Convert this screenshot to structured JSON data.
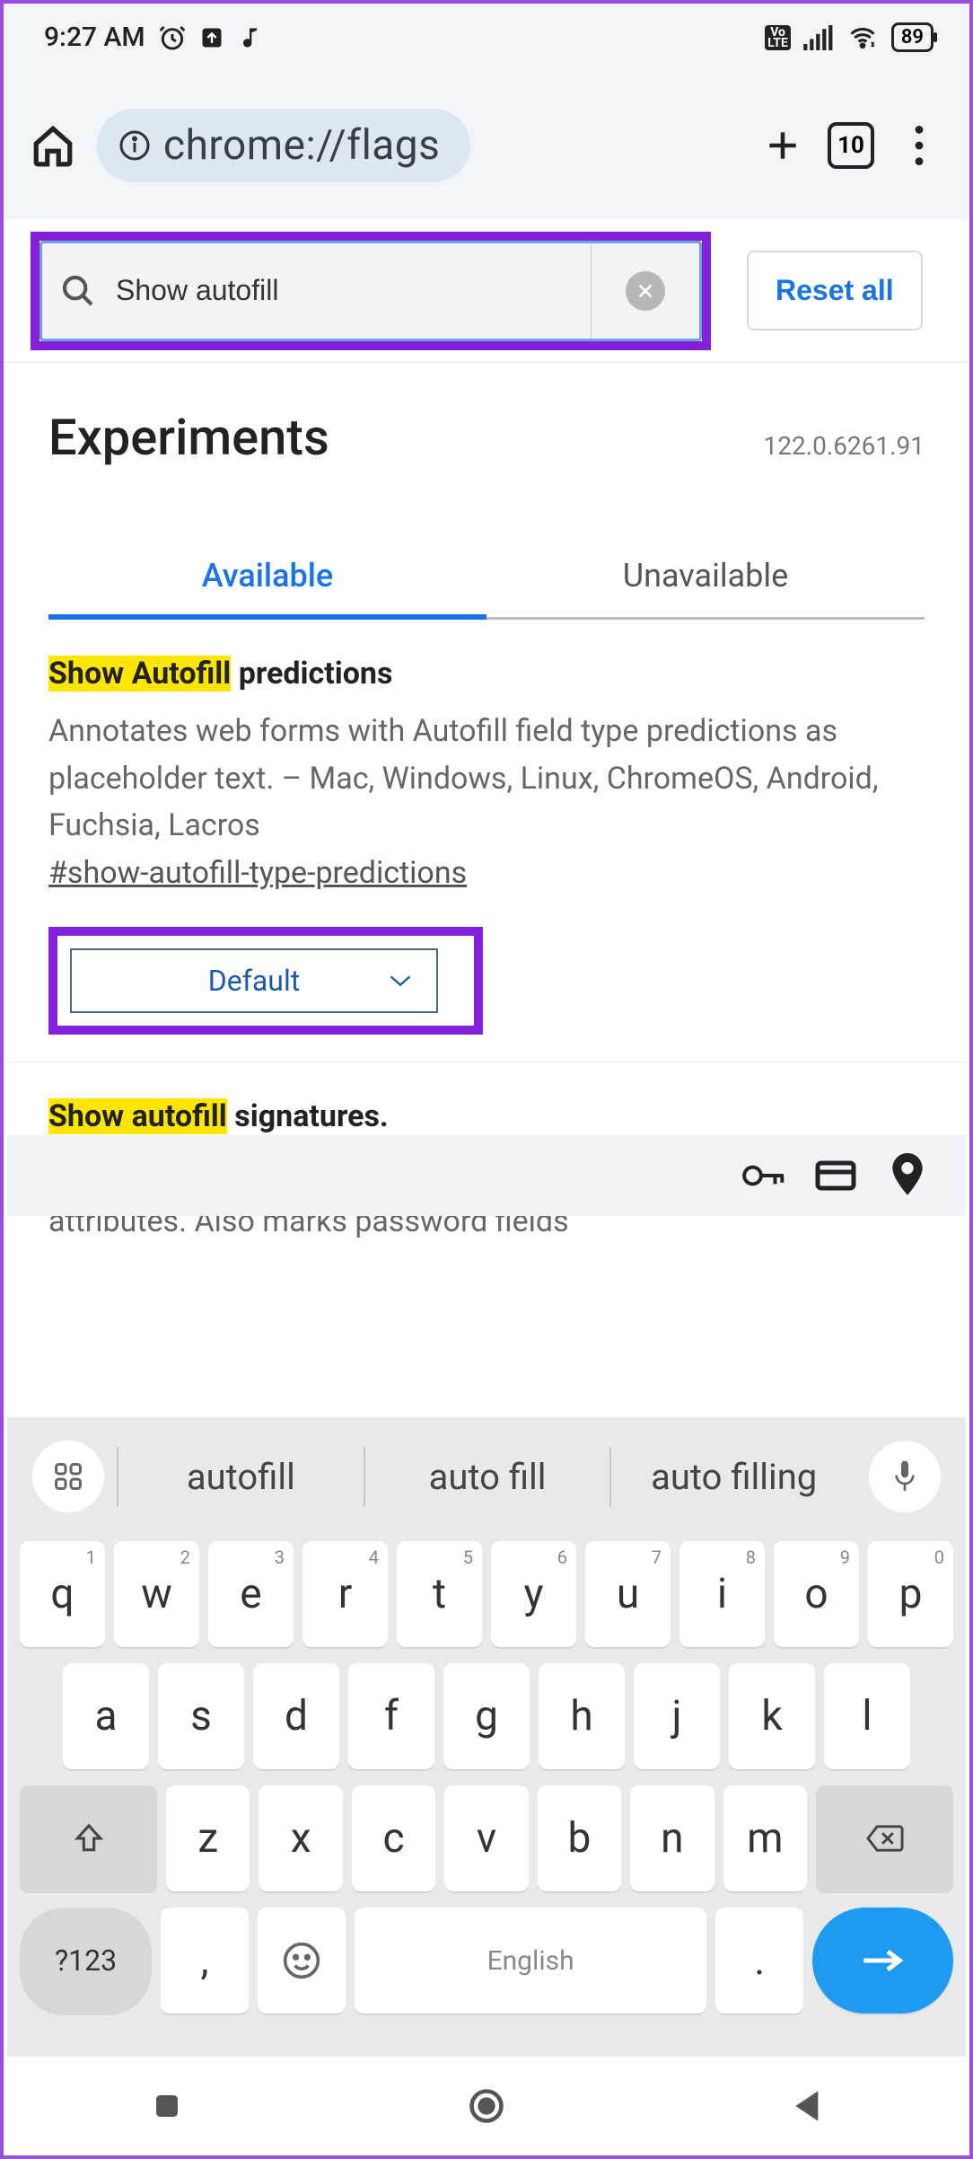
{
  "status": {
    "time": "9:27 AM",
    "battery": "89",
    "volte": "Vo\nLTE"
  },
  "browser": {
    "url": "chrome://flags",
    "tab_count": "10"
  },
  "flags_page": {
    "search_value": "Show autofill",
    "reset_label": "Reset all",
    "title": "Experiments",
    "version": "122.0.6261.91",
    "tabs": {
      "available": "Available",
      "unavailable": "Unavailable"
    },
    "flag1": {
      "title_hl": "Show Autofill",
      "title_rest": " predictions",
      "desc": "Annotates web forms with Autofill field type predictions as placeholder text. – Mac, Windows, Linux, ChromeOS, Android, Fuchsia, Lacros",
      "hash": "#show-autofill-type-predictions",
      "dropdown": "Default"
    },
    "flag2": {
      "title_hl": "Show autofill",
      "title_rest": " signatures.",
      "desc": "Annotates web forms with Autofill signatures as HTML attributes. Also marks password fields"
    }
  },
  "keyboard": {
    "suggestions": [
      "autofill",
      "auto fill",
      "auto filling"
    ],
    "row1": [
      {
        "k": "q",
        "s": "1"
      },
      {
        "k": "w",
        "s": "2"
      },
      {
        "k": "e",
        "s": "3"
      },
      {
        "k": "r",
        "s": "4"
      },
      {
        "k": "t",
        "s": "5"
      },
      {
        "k": "y",
        "s": "6"
      },
      {
        "k": "u",
        "s": "7"
      },
      {
        "k": "i",
        "s": "8"
      },
      {
        "k": "o",
        "s": "9"
      },
      {
        "k": "p",
        "s": "0"
      }
    ],
    "row2": [
      "a",
      "s",
      "d",
      "f",
      "g",
      "h",
      "j",
      "k",
      "l"
    ],
    "row3": [
      "z",
      "x",
      "c",
      "v",
      "b",
      "n",
      "m"
    ],
    "symkey": "?123",
    "comma": ",",
    "space": "English",
    "period": "."
  }
}
